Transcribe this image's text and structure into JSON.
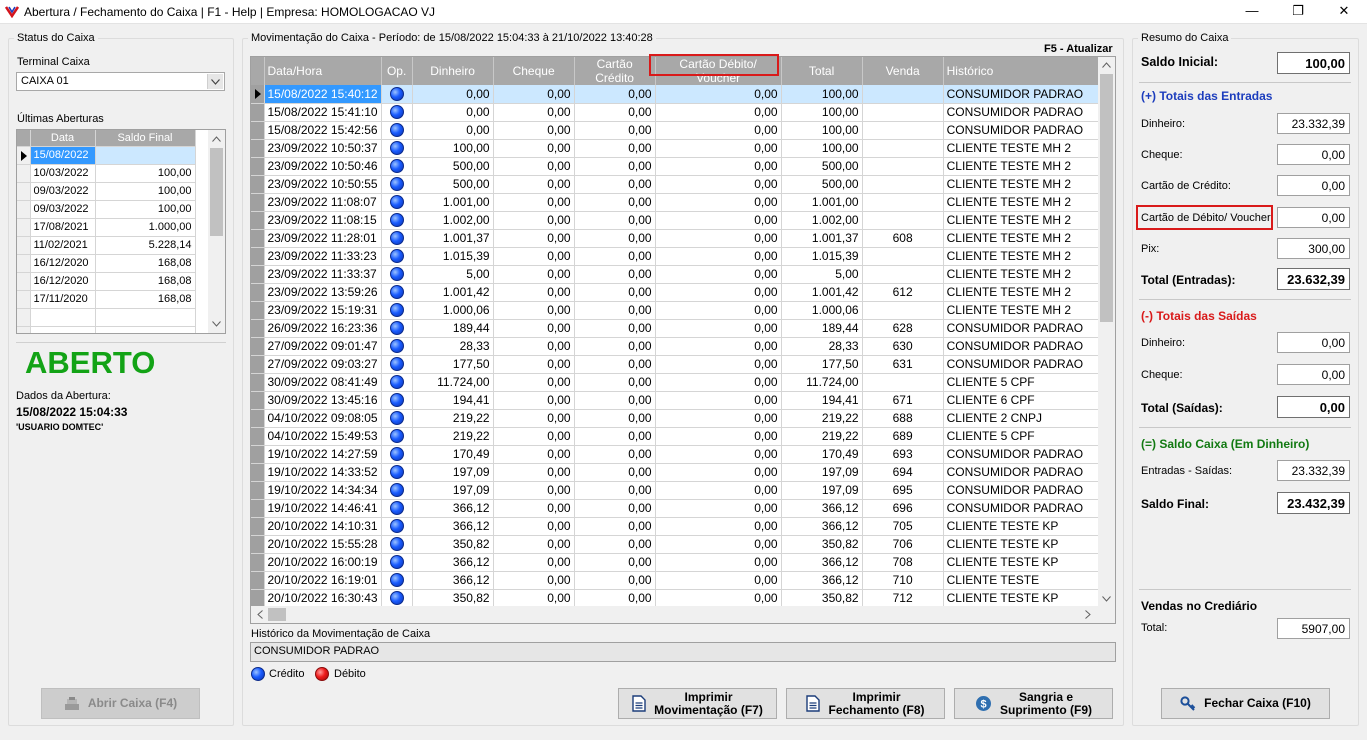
{
  "window": {
    "title": "Abertura / Fechamento do Caixa | F1 - Help | Empresa: HOMOLOGACAO VJ",
    "minimize": "—",
    "maximize": "❐",
    "close": "✕"
  },
  "status": {
    "legend": "Status do Caixa",
    "terminal_label": "Terminal Caixa",
    "terminal_value": "CAIXA 01",
    "ultimas_label": "Últimas Aberturas",
    "headers": [
      "Data",
      "Saldo Final"
    ],
    "rows": [
      [
        "15/08/2022",
        ""
      ],
      [
        "10/03/2022",
        "100,00"
      ],
      [
        "09/03/2022",
        "100,00"
      ],
      [
        "09/03/2022",
        "100,00"
      ],
      [
        "17/08/2021",
        "1.000,00"
      ],
      [
        "11/02/2021",
        "5.228,14"
      ],
      [
        "16/12/2020",
        "168,08"
      ],
      [
        "16/12/2020",
        "168,08"
      ],
      [
        "17/11/2020",
        "168,08"
      ]
    ],
    "state": "ABERTO",
    "dados_label": "Dados da Abertura:",
    "dados_datetime": "15/08/2022 15:04:33",
    "dados_user": "'USUARIO DOMTEC'",
    "abrir_button": "Abrir Caixa (F4)"
  },
  "mov": {
    "legend": "Movimentação do Caixa - Período: de 15/08/2022 15:04:33 à 21/10/2022 13:40:28",
    "refresh": "F5 - Atualizar",
    "headers": [
      "Data/Hora",
      "Op.",
      "Dinheiro",
      "Cheque",
      "Cartão Crédito",
      "Cartão Débito/ Voucher",
      "Total",
      "Venda",
      "Histórico"
    ],
    "rows": [
      [
        "15/08/2022 15:40:12",
        "c",
        "0,00",
        "0,00",
        "0,00",
        "0,00",
        "100,00",
        "",
        "CONSUMIDOR PADRAO"
      ],
      [
        "15/08/2022 15:41:10",
        "c",
        "0,00",
        "0,00",
        "0,00",
        "0,00",
        "100,00",
        "",
        "CONSUMIDOR PADRAO"
      ],
      [
        "15/08/2022 15:42:56",
        "c",
        "0,00",
        "0,00",
        "0,00",
        "0,00",
        "100,00",
        "",
        "CONSUMIDOR PADRAO"
      ],
      [
        "23/09/2022 10:50:37",
        "c",
        "100,00",
        "0,00",
        "0,00",
        "0,00",
        "100,00",
        "",
        "CLIENTE TESTE MH 2"
      ],
      [
        "23/09/2022 10:50:46",
        "c",
        "500,00",
        "0,00",
        "0,00",
        "0,00",
        "500,00",
        "",
        "CLIENTE TESTE MH 2"
      ],
      [
        "23/09/2022 10:50:55",
        "c",
        "500,00",
        "0,00",
        "0,00",
        "0,00",
        "500,00",
        "",
        "CLIENTE TESTE MH 2"
      ],
      [
        "23/09/2022 11:08:07",
        "c",
        "1.001,00",
        "0,00",
        "0,00",
        "0,00",
        "1.001,00",
        "",
        "CLIENTE TESTE MH 2"
      ],
      [
        "23/09/2022 11:08:15",
        "c",
        "1.002,00",
        "0,00",
        "0,00",
        "0,00",
        "1.002,00",
        "",
        "CLIENTE TESTE MH 2"
      ],
      [
        "23/09/2022 11:28:01",
        "c",
        "1.001,37",
        "0,00",
        "0,00",
        "0,00",
        "1.001,37",
        "608",
        "CLIENTE TESTE MH 2"
      ],
      [
        "23/09/2022 11:33:23",
        "c",
        "1.015,39",
        "0,00",
        "0,00",
        "0,00",
        "1.015,39",
        "",
        "CLIENTE TESTE MH 2"
      ],
      [
        "23/09/2022 11:33:37",
        "c",
        "5,00",
        "0,00",
        "0,00",
        "0,00",
        "5,00",
        "",
        "CLIENTE TESTE MH 2"
      ],
      [
        "23/09/2022 13:59:26",
        "c",
        "1.001,42",
        "0,00",
        "0,00",
        "0,00",
        "1.001,42",
        "612",
        "CLIENTE TESTE MH 2"
      ],
      [
        "23/09/2022 15:19:31",
        "c",
        "1.000,06",
        "0,00",
        "0,00",
        "0,00",
        "1.000,06",
        "",
        "CLIENTE TESTE MH 2"
      ],
      [
        "26/09/2022 16:23:36",
        "c",
        "189,44",
        "0,00",
        "0,00",
        "0,00",
        "189,44",
        "628",
        "CONSUMIDOR PADRAO"
      ],
      [
        "27/09/2022 09:01:47",
        "c",
        "28,33",
        "0,00",
        "0,00",
        "0,00",
        "28,33",
        "630",
        "CONSUMIDOR PADRAO"
      ],
      [
        "27/09/2022 09:03:27",
        "c",
        "177,50",
        "0,00",
        "0,00",
        "0,00",
        "177,50",
        "631",
        "CONSUMIDOR PADRAO"
      ],
      [
        "30/09/2022 08:41:49",
        "c",
        "11.724,00",
        "0,00",
        "0,00",
        "0,00",
        "11.724,00",
        "",
        "CLIENTE 5 CPF"
      ],
      [
        "30/09/2022 13:45:16",
        "c",
        "194,41",
        "0,00",
        "0,00",
        "0,00",
        "194,41",
        "671",
        "CLIENTE 6 CPF"
      ],
      [
        "04/10/2022 09:08:05",
        "c",
        "219,22",
        "0,00",
        "0,00",
        "0,00",
        "219,22",
        "688",
        "CLIENTE 2 CNPJ"
      ],
      [
        "04/10/2022 15:49:53",
        "c",
        "219,22",
        "0,00",
        "0,00",
        "0,00",
        "219,22",
        "689",
        "CLIENTE 5 CPF"
      ],
      [
        "19/10/2022 14:27:59",
        "c",
        "170,49",
        "0,00",
        "0,00",
        "0,00",
        "170,49",
        "693",
        "CONSUMIDOR PADRAO"
      ],
      [
        "19/10/2022 14:33:52",
        "c",
        "197,09",
        "0,00",
        "0,00",
        "0,00",
        "197,09",
        "694",
        "CONSUMIDOR PADRAO"
      ],
      [
        "19/10/2022 14:34:34",
        "c",
        "197,09",
        "0,00",
        "0,00",
        "0,00",
        "197,09",
        "695",
        "CONSUMIDOR PADRAO"
      ],
      [
        "19/10/2022 14:46:41",
        "c",
        "366,12",
        "0,00",
        "0,00",
        "0,00",
        "366,12",
        "696",
        "CONSUMIDOR PADRAO"
      ],
      [
        "20/10/2022 14:10:31",
        "c",
        "366,12",
        "0,00",
        "0,00",
        "0,00",
        "366,12",
        "705",
        "CLIENTE TESTE KP"
      ],
      [
        "20/10/2022 15:55:28",
        "c",
        "350,82",
        "0,00",
        "0,00",
        "0,00",
        "350,82",
        "706",
        "CLIENTE TESTE KP"
      ],
      [
        "20/10/2022 16:00:19",
        "c",
        "366,12",
        "0,00",
        "0,00",
        "0,00",
        "366,12",
        "708",
        "CLIENTE TESTE KP"
      ],
      [
        "20/10/2022 16:19:01",
        "c",
        "366,12",
        "0,00",
        "0,00",
        "0,00",
        "366,12",
        "710",
        "CLIENTE TESTE"
      ],
      [
        "20/10/2022 16:30:43",
        "c",
        "350,82",
        "0,00",
        "0,00",
        "0,00",
        "350,82",
        "712",
        "CLIENTE TESTE KP"
      ]
    ],
    "hist_label": "Histórico da Movimentação de Caixa",
    "hist_value": "CONSUMIDOR PADRAO",
    "legend_credit": "Crédito",
    "legend_debit": "Débito",
    "btn_mov": [
      "Imprimir",
      "Movimentação (F7)"
    ],
    "btn_fech": [
      "Imprimir",
      "Fechamento (F8)"
    ],
    "btn_sangria": [
      "Sangria e",
      "Suprimento (F9)"
    ]
  },
  "resumo": {
    "legend": "Resumo do Caixa",
    "saldo_inicial_label": "Saldo Inicial:",
    "saldo_inicial": "100,00",
    "entradas_header": "(+) Totais das Entradas",
    "ent_dinheiro_label": "Dinheiro:",
    "ent_dinheiro": "23.332,39",
    "ent_cheque_label": "Cheque:",
    "ent_cheque": "0,00",
    "ent_credito_label": "Cartão de Crédito:",
    "ent_credito": "0,00",
    "ent_debito_label": "Cartão de Débito/ Voucher:",
    "ent_debito": "0,00",
    "ent_pix_label": "Pix:",
    "ent_pix": "300,00",
    "total_entradas_label": "Total (Entradas):",
    "total_entradas": "23.632,39",
    "saidas_header": "(-) Totais das Saídas",
    "sai_dinheiro_label": "Dinheiro:",
    "sai_dinheiro": "0,00",
    "sai_cheque_label": "Cheque:",
    "sai_cheque": "0,00",
    "total_saidas_label": "Total (Saídas):",
    "total_saidas": "0,00",
    "saldo_header": "(=) Saldo Caixa (Em Dinheiro)",
    "ent_sai_label": "Entradas - Saídas:",
    "ent_sai": "23.332,39",
    "saldo_final_label": "Saldo Final:",
    "saldo_final": "23.432,39",
    "crediario_header": "Vendas no Crediário",
    "crediario_total_label": "Total:",
    "crediario_total": "5907,00",
    "fechar_button": "Fechar Caixa (F10)"
  },
  "colors": {
    "selection": "#3399ff",
    "grid_header": "#a8a8a8",
    "aberto": "#13a316",
    "entradas": "#1c3dbd",
    "saidas": "#d91a1a",
    "saldo": "#127a12",
    "highlight": "#d91a1a"
  }
}
